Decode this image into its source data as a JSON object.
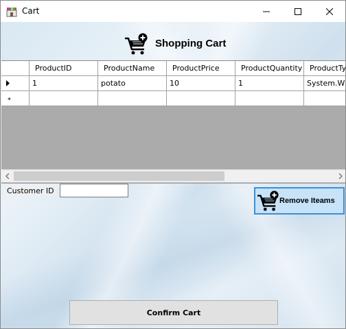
{
  "window": {
    "title": "Cart"
  },
  "header": {
    "title": "Shopping Cart",
    "icon": "cart-plus-icon"
  },
  "grid": {
    "columns": [
      "ProductID",
      "ProductName",
      "ProductPrice",
      "ProductQuantity",
      "ProductTyp"
    ],
    "rows": [
      {
        "cells": [
          "1",
          "potato",
          "10",
          "1",
          "System.Wind"
        ]
      },
      {
        "cells": [
          "",
          "",
          "",
          "",
          ""
        ]
      }
    ],
    "background": "#ababab",
    "row_markers": [
      "current-row-icon",
      "new-row-icon"
    ]
  },
  "customer": {
    "label": "Customer ID",
    "value": ""
  },
  "actions": {
    "remove_label": "Remove Iteams",
    "confirm_label": "Confirm Cart"
  },
  "colors": {
    "remove_border": "#3a8fd6",
    "remove_background": "#c8e2f7"
  }
}
